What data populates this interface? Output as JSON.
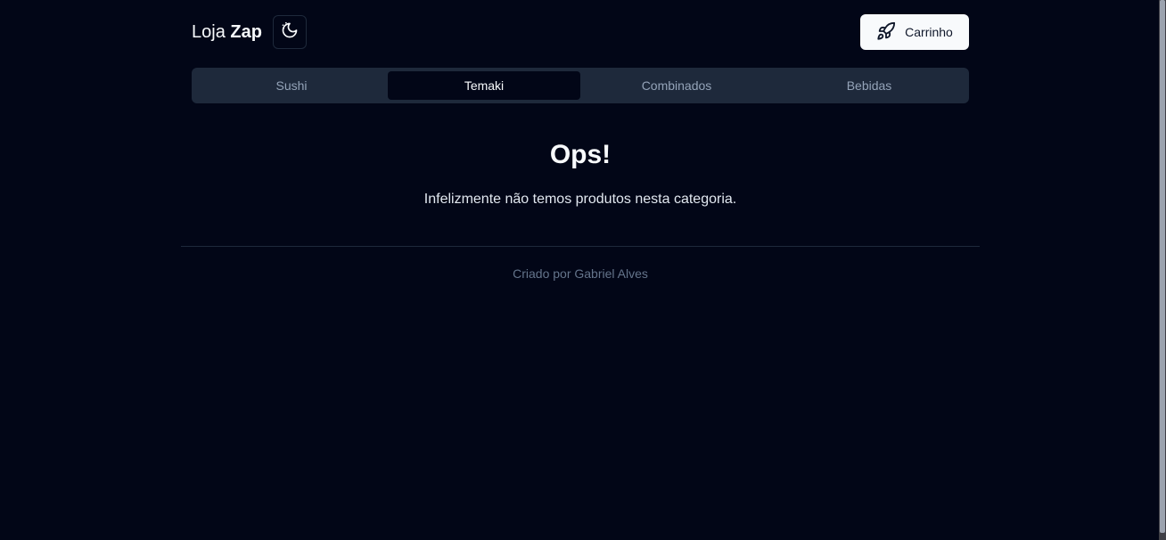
{
  "brand": {
    "name_light": "Loja",
    "name_bold": "Zap"
  },
  "header": {
    "theme_toggle_icon": "moon-icon",
    "cart": {
      "icon": "rocket-icon",
      "label": "Carrinho"
    }
  },
  "tabs": [
    {
      "label": "Sushi",
      "active": false
    },
    {
      "label": "Temaki",
      "active": true
    },
    {
      "label": "Combinados",
      "active": false
    },
    {
      "label": "Bebidas",
      "active": false
    }
  ],
  "empty_state": {
    "title": "Ops!",
    "message": "Infelizmente não temos produtos nesta categoria."
  },
  "footer": {
    "text": "Criado por Gabriel Alves"
  },
  "colors": {
    "background": "#020617",
    "tab_bar": "#1e293b",
    "active_tab": "#020617",
    "cart_button": "#f8fafc"
  }
}
